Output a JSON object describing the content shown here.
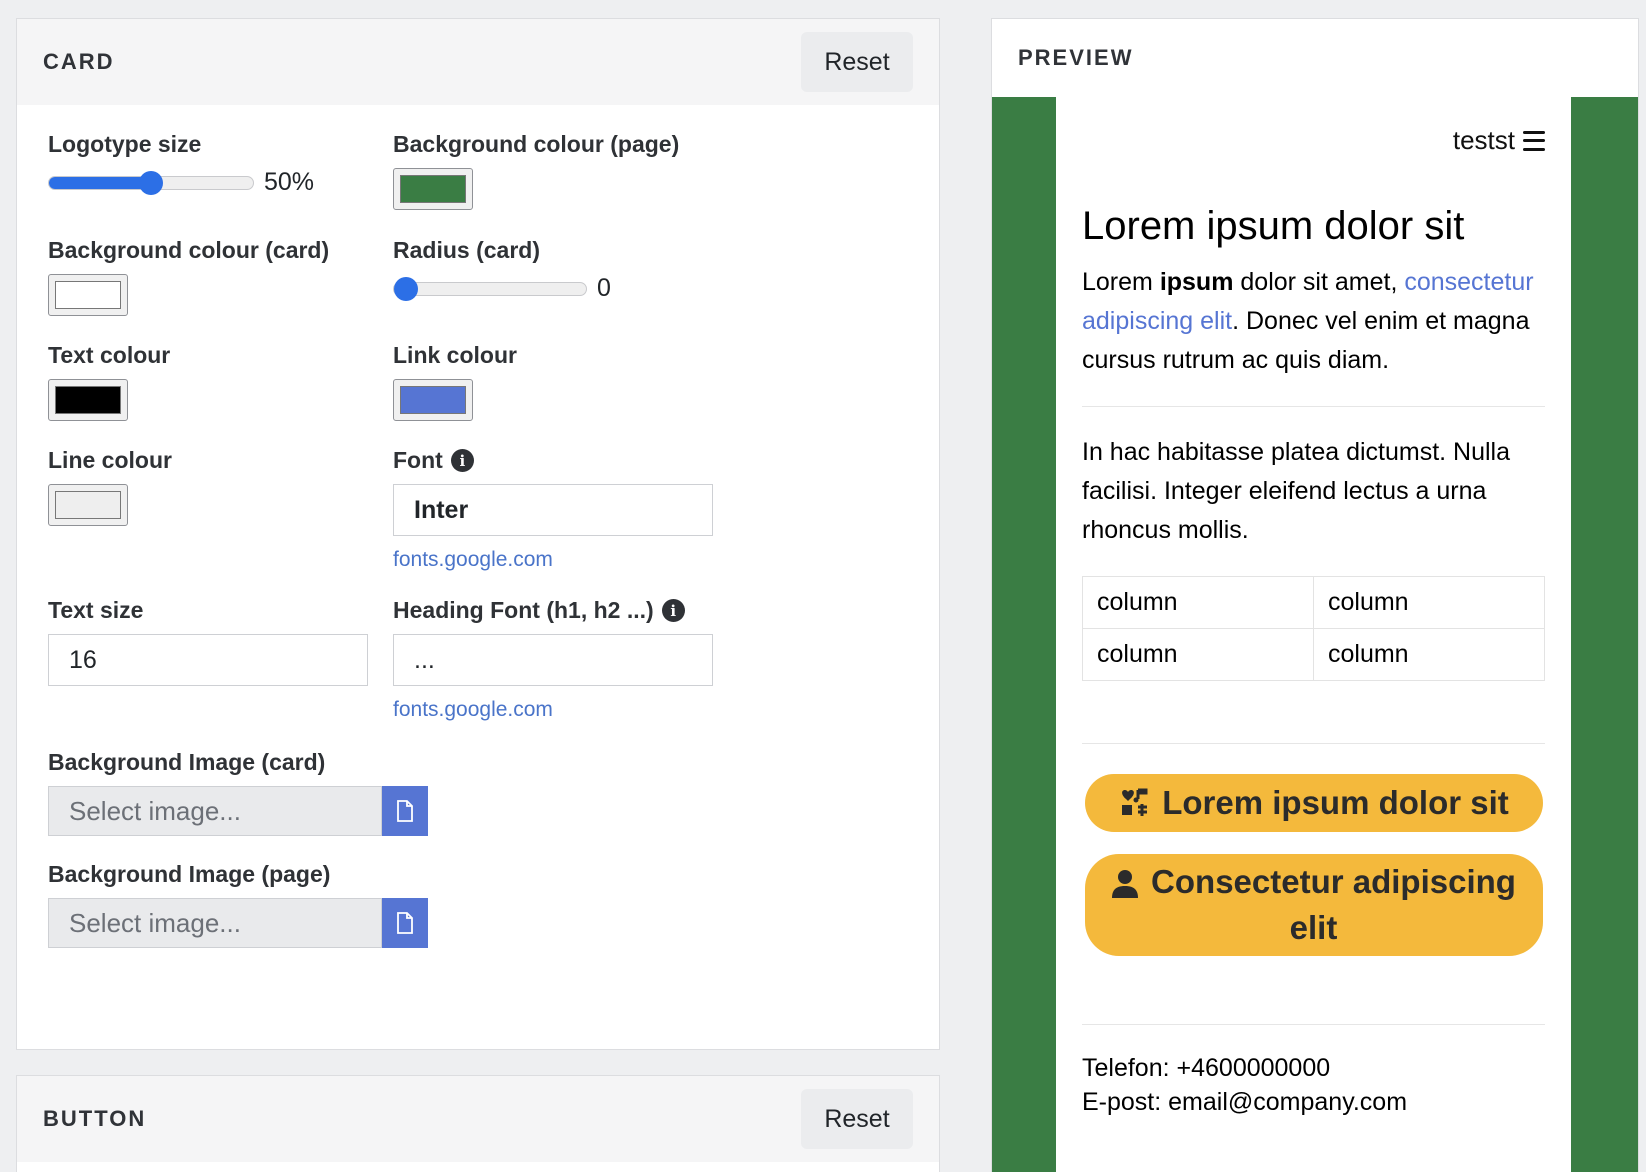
{
  "card_panel": {
    "title": "CARD",
    "reset_label": "Reset",
    "logotype_size": {
      "label": "Logotype size",
      "value": 50,
      "value_text": "50%"
    },
    "bg_page": {
      "label": "Background colour (page)",
      "color": "#3a7d44"
    },
    "bg_card": {
      "label": "Background colour (card)",
      "color": "#ffffff"
    },
    "radius": {
      "label": "Radius (card)",
      "value": 0,
      "value_text": "0"
    },
    "text_colour": {
      "label": "Text colour",
      "color": "#000000"
    },
    "link_colour": {
      "label": "Link colour",
      "color": "#5675d3"
    },
    "line_colour": {
      "label": "Line colour",
      "color": "#eeeeee"
    },
    "font": {
      "label": "Font",
      "value": "Inter",
      "link": "fonts.google.com"
    },
    "text_size": {
      "label": "Text size",
      "value": "16"
    },
    "heading_font": {
      "label": "Heading Font (h1, h2 ...)",
      "value": "...",
      "link": "fonts.google.com"
    },
    "bg_image_card": {
      "label": "Background Image (card)",
      "placeholder": "Select image..."
    },
    "bg_image_page": {
      "label": "Background Image (page)",
      "placeholder": "Select image..."
    }
  },
  "button_panel": {
    "title": "BUTTON",
    "reset_label": "Reset"
  },
  "preview": {
    "title": "PREVIEW",
    "nav_text": "testst",
    "heading": "Lorem ipsum dolor sit",
    "para1_before": "Lorem ",
    "para1_bold": "ipsum",
    "para1_mid": " dolor sit amet, ",
    "para1_link": "consectetur adipiscing elit",
    "para1_after": ". Donec vel enim et magna cursus rutrum ac quis diam.",
    "para2": "In hac habitasse platea dictumst. Nulla facilisi. Integer eleifend lectus a urna rhoncus mollis.",
    "table": [
      [
        "column",
        "column"
      ],
      [
        "column",
        "column"
      ]
    ],
    "button1": "Lorem ipsum dolor sit",
    "button2": "Consectetur adipiscing elit",
    "phone": "Telefon: +4600000000",
    "email": "E-post: email@company.com",
    "button_color": "#f4b93c"
  }
}
